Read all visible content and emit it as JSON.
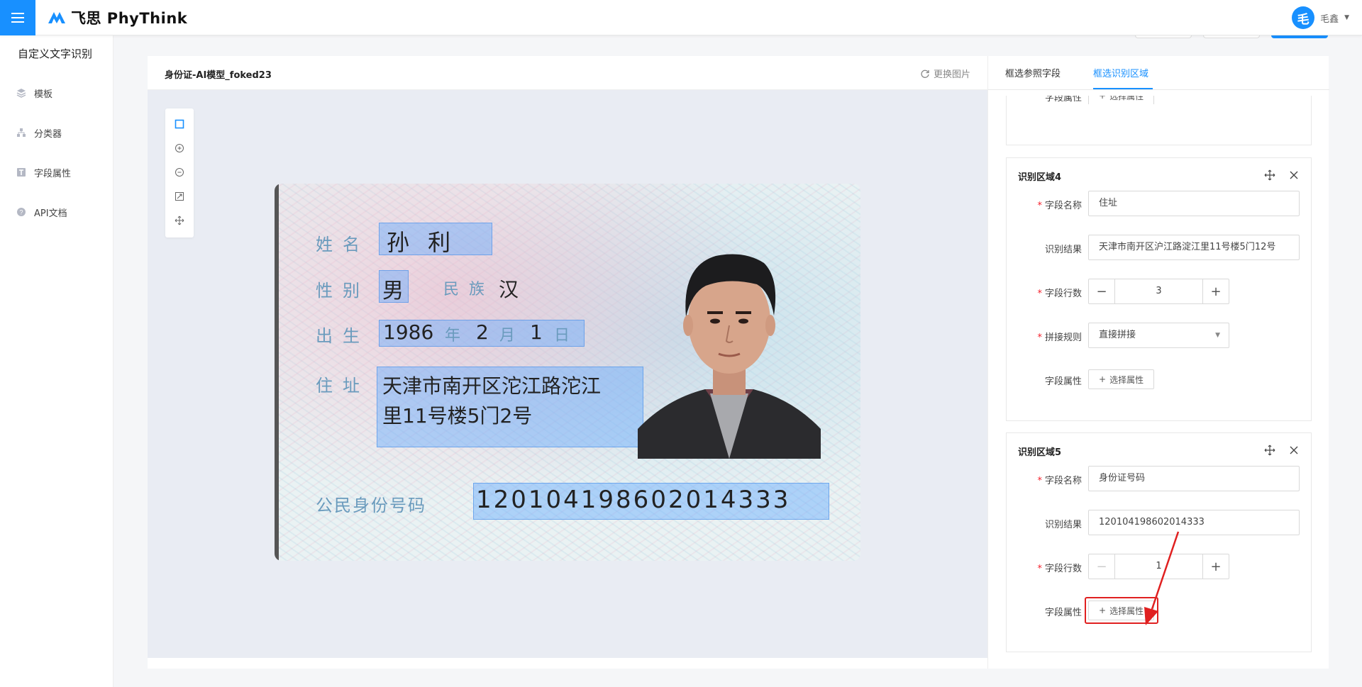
{
  "brand": {
    "name": "飞思 PhyThink"
  },
  "user": {
    "avatar_char": "毛",
    "name": "毛鑫"
  },
  "sidebar": {
    "title": "自定义文字识别",
    "items": [
      {
        "label": "模板",
        "icon": "layers-icon"
      },
      {
        "label": "分类器",
        "icon": "hierarchy-icon"
      },
      {
        "label": "字段属性",
        "icon": "text-field-icon"
      },
      {
        "label": "API文档",
        "icon": "help-icon"
      }
    ]
  },
  "canvas": {
    "title": "身份证-AI模型_foked23",
    "swap_label": "更换图片"
  },
  "idcard": {
    "label_name": "姓名",
    "value_name": "孙 利",
    "label_gender": "性别",
    "value_gender": "男",
    "label_ethnic": "民族",
    "value_ethnic": "汉",
    "label_birth": "出生",
    "birth_year": "1986",
    "birth_year_unit": "年",
    "birth_month": "2",
    "birth_month_unit": "月",
    "birth_day": "1",
    "birth_day_unit": "日",
    "label_address": "住址",
    "address_line1": "天津市南开区沱江路沱江",
    "address_line2": "里11号楼5门2号",
    "label_id": "公民身份号码",
    "value_id": "120104198602014333"
  },
  "panel": {
    "tabs": [
      "框选参照字段",
      "框选识别区域"
    ],
    "active_tab": 1,
    "regions": [
      {
        "title": "识别区域4",
        "field_name_label": "字段名称",
        "field_name": "住址",
        "result_label": "识别结果",
        "result": "天津市南开区沪江路淀江里11号楼5门12号",
        "lines_label": "字段行数",
        "lines": "3",
        "join_label": "拼接规则",
        "join_value": "直接拼接",
        "attr_label": "字段属性",
        "attr_button": "选择属性"
      },
      {
        "title": "识别区域5",
        "field_name_label": "字段名称",
        "field_name": "身份证号码",
        "result_label": "识别结果",
        "result": "120104198602014333",
        "lines_label": "字段行数",
        "lines": "1",
        "attr_label": "字段属性",
        "attr_button": "选择属性"
      }
    ],
    "prev_region": {
      "attr_label": "字段属性",
      "attr_button": "选择属性"
    }
  },
  "colors": {
    "accent": "#1890ff",
    "required": "#f5222d",
    "annotation": "#e02020"
  }
}
